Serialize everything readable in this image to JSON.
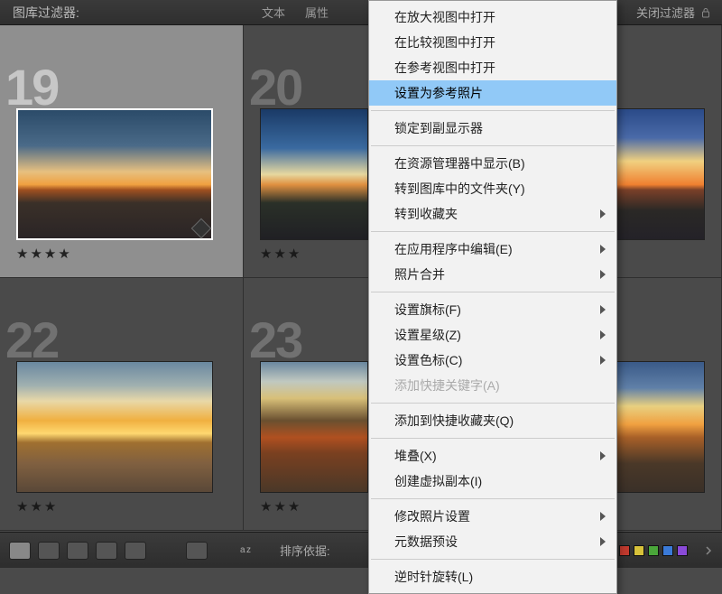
{
  "filter_bar": {
    "title": "图库过滤器:",
    "tab_text": "文本",
    "tab_attr": "属性",
    "close_label": "关闭过滤器"
  },
  "cells": {
    "c19": {
      "num": "19",
      "stars": "★★★★"
    },
    "c20": {
      "num": "20",
      "stars": "★★★"
    },
    "c21": {
      "num": "",
      "stars": ""
    },
    "c22": {
      "num": "22",
      "stars": "★★★"
    },
    "c23": {
      "num": "23",
      "stars": "★★★"
    },
    "c24": {
      "num": "",
      "stars": ""
    }
  },
  "menu": {
    "open_in_loupe": "在放大视图中打开",
    "open_in_compare": "在比较视图中打开",
    "open_in_reference": "在参考视图中打开",
    "set_as_reference": "设置为参考照片",
    "lock_to_second": "锁定到副显示器",
    "show_in_explorer": "在资源管理器中显示(B)",
    "go_to_folder": "转到图库中的文件夹(Y)",
    "go_to_collection": "转到收藏夹",
    "edit_in_app": "在应用程序中编辑(E)",
    "photo_merge": "照片合并",
    "set_flag": "设置旗标(F)",
    "set_rating": "设置星级(Z)",
    "set_color": "设置色标(C)",
    "add_shortcut_keyword": "添加快捷关键字(A)",
    "add_to_quick_collection": "添加到快捷收藏夹(Q)",
    "stacking": "堆叠(X)",
    "create_virtual_copy": "创建虚拟副本(I)",
    "develop_settings": "修改照片设置",
    "metadata_presets": "元数据预设",
    "rotate_ccw": "逆时针旋转(L)"
  },
  "status": {
    "sort_by": "排序依据:"
  },
  "colors": {
    "red": "#c23a2e",
    "yellow": "#d8c23a",
    "green": "#4aa63a",
    "blue": "#3a7ad8",
    "purple": "#8a4ad8"
  }
}
